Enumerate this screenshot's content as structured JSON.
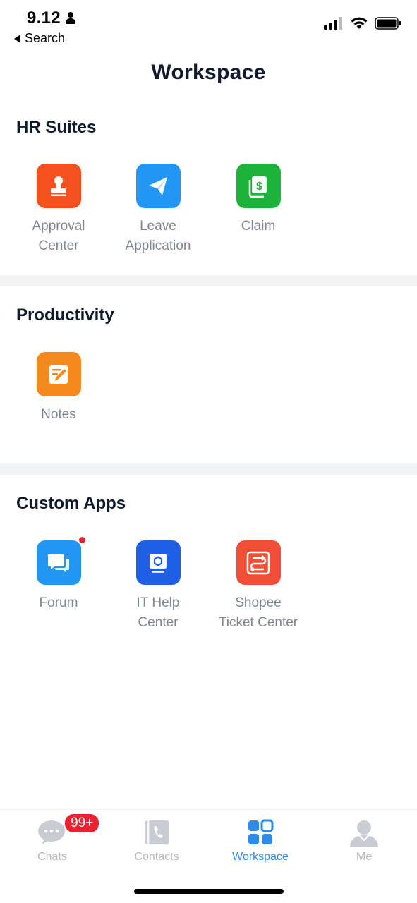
{
  "status_bar": {
    "time": "9.12",
    "back_label": "Search"
  },
  "header": {
    "title": "Workspace"
  },
  "sections": [
    {
      "title": "HR Suites",
      "apps": [
        {
          "label": "Approval\nCenter",
          "icon": "stamp-icon",
          "color": "#f4511e"
        },
        {
          "label": "Leave\nApplication",
          "icon": "paper-plane-icon",
          "color": "#2196f3"
        },
        {
          "label": "Claim",
          "icon": "dollar-receipt-icon",
          "color": "#1db33a"
        }
      ]
    },
    {
      "title": "Productivity",
      "apps": [
        {
          "label": "Notes",
          "icon": "note-pencil-icon",
          "color": "#f5891f"
        }
      ]
    },
    {
      "title": "Custom Apps",
      "apps": [
        {
          "label": "Forum",
          "icon": "chat-bubbles-icon",
          "color": "#2196f3",
          "has_notification_dot": true
        },
        {
          "label": "IT Help\nCenter",
          "icon": "monitor-icon",
          "color": "#1e5fe6"
        },
        {
          "label": "Shopee\nTicket Center",
          "icon": "route-icon",
          "color": "#f04e37"
        }
      ]
    }
  ],
  "bottom_nav": {
    "items": [
      {
        "label": "Chats",
        "icon": "chat-icon",
        "badge": "99+"
      },
      {
        "label": "Contacts",
        "icon": "contacts-book-icon"
      },
      {
        "label": "Workspace",
        "icon": "grid-apps-icon",
        "active": true
      },
      {
        "label": "Me",
        "icon": "person-icon"
      }
    ]
  },
  "colors": {
    "accent": "#2d8ce8",
    "badge": "#e8232f",
    "label_gray": "#7d8591",
    "inactive_nav": "#b3b8c0"
  }
}
